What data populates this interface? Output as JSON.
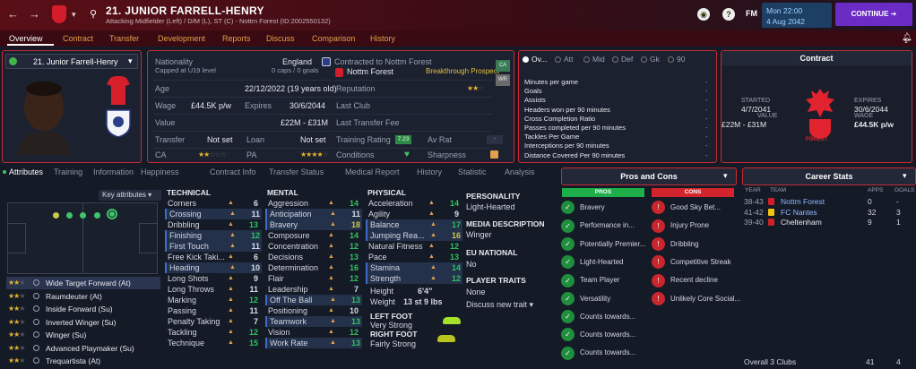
{
  "header": {
    "player_name": "21. JUNIOR FARRELL-HENRY",
    "player_subtitle": "Attacking Midfielder (Left) / D/M (L), ST (C) - Nottm Forest (ID:2002550132)",
    "date_line1": "Mon 22:00",
    "date_line2": "4 Aug 2042",
    "continue_label": "CONTINUE",
    "fm_label": "FM",
    "notification_count": "1"
  },
  "menu": [
    "Overview",
    "Contract",
    "Transfer",
    "Development",
    "Reports",
    "Discuss",
    "Comparison",
    "History"
  ],
  "profile": {
    "selector_label": "21. Junior Farrell-Henry",
    "nationality_label": "Nationality",
    "nationality_value": "England",
    "caps_label": "Capped at U19 level",
    "caps_value": "0 caps / 0 goals",
    "contracted_label": "Contracted to Nottm Forest",
    "club_value": "Nottm Forest",
    "prospect": "Breakthrough Prospect",
    "age_label": "Age",
    "age_value": "22/12/2022 (19 years old)",
    "wage_label": "Wage",
    "wage_value": "£44.5K p/w",
    "expires_label": "Expires",
    "expires_value": "30/6/2044",
    "value_label": "Value",
    "value_value": "£22M - £31M",
    "transfer_label": "Transfer",
    "transfer_value": "Not set",
    "loan_label": "Loan",
    "loan_value": "Not set",
    "ca_label": "CA",
    "pa_label": "PA",
    "reputation_label": "Reputation",
    "last_club_label": "Last Club",
    "last_transfer_label": "Last Transfer Fee",
    "training_label": "Training Rating",
    "training_value": "7.23",
    "avrat_label": "Av Rat",
    "avrat_value": "-",
    "conditions_label": "Conditions",
    "sharpness_label": "Sharpness",
    "badge_top": "CA",
    "badge_bottom": "WR"
  },
  "stats_panel": {
    "tabs": [
      "Ov...",
      "Att",
      "Mid",
      "Def",
      "Gk",
      "90"
    ],
    "rows": [
      {
        "label": "Minutes per game",
        "value": "-"
      },
      {
        "label": "Goals",
        "value": "-"
      },
      {
        "label": "Assists",
        "value": "-"
      },
      {
        "label": "Headers won per 90 minutes",
        "value": "-"
      },
      {
        "label": "Cross Completion Ratio",
        "value": "-"
      },
      {
        "label": "Passes completed per 90 minutes",
        "value": "-"
      },
      {
        "label": "Tackles Per Game",
        "value": "-"
      },
      {
        "label": "Interceptions per 90 minutes",
        "value": "-"
      },
      {
        "label": "Distance Covered Per 90 minutes",
        "value": "-"
      }
    ]
  },
  "contract": {
    "title": "Contract",
    "started_label": "STARTED",
    "started_value": "4/7/2041",
    "value_label": "VALUE",
    "value_value": "£22M - £31M",
    "expires_label": "EXPIRES",
    "expires_value": "30/6/2044",
    "wage_label": "WAGE",
    "wage_value": "£44.5K p/w",
    "crest_text": "FOREST"
  },
  "subnav": [
    "Attributes",
    "Training",
    "Information",
    "Happiness",
    "Contract Info",
    "Transfer Status",
    "Medical Report",
    "History",
    "Statistic",
    "Analysis"
  ],
  "key_attributes_label": "Key attributes",
  "technical": {
    "title": "TECHNICAL",
    "items": [
      {
        "name": "Corners",
        "value": "6",
        "color": "w",
        "hl": false
      },
      {
        "name": "Crossing",
        "value": "11",
        "color": "w",
        "hl": true
      },
      {
        "name": "Dribbling",
        "value": "13",
        "color": "g",
        "hl": false
      },
      {
        "name": "Finishing",
        "value": "12",
        "color": "g",
        "hl": true
      },
      {
        "name": "First Touch",
        "value": "11",
        "color": "w",
        "hl": true
      },
      {
        "name": "Free Kick Taki...",
        "value": "6",
        "color": "w",
        "hl": false
      },
      {
        "name": "Heading",
        "value": "10",
        "color": "w",
        "hl": true
      },
      {
        "name": "Long Shots",
        "value": "9",
        "color": "w",
        "hl": false
      },
      {
        "name": "Long Throws",
        "value": "11",
        "color": "w",
        "hl": false
      },
      {
        "name": "Marking",
        "value": "12",
        "color": "g",
        "hl": false
      },
      {
        "name": "Passing",
        "value": "11",
        "color": "w",
        "hl": false
      },
      {
        "name": "Penalty Taking",
        "value": "7",
        "color": "w",
        "hl": false
      },
      {
        "name": "Tackling",
        "value": "12",
        "color": "g",
        "hl": false
      },
      {
        "name": "Technique",
        "value": "15",
        "color": "g",
        "hl": false
      }
    ]
  },
  "mental": {
    "title": "MENTAL",
    "items": [
      {
        "name": "Aggression",
        "value": "14",
        "color": "g",
        "hl": false
      },
      {
        "name": "Anticipation",
        "value": "11",
        "color": "w",
        "hl": true
      },
      {
        "name": "Bravery",
        "value": "18",
        "color": "y",
        "hl": true
      },
      {
        "name": "Composure",
        "value": "14",
        "color": "g",
        "hl": false
      },
      {
        "name": "Concentration",
        "value": "12",
        "color": "g",
        "hl": false
      },
      {
        "name": "Decisions",
        "value": "13",
        "color": "g",
        "hl": false
      },
      {
        "name": "Determination",
        "value": "16",
        "color": "g",
        "hl": false
      },
      {
        "name": "Flair",
        "value": "12",
        "color": "g",
        "hl": false
      },
      {
        "name": "Leadership",
        "value": "7",
        "color": "w",
        "hl": false
      },
      {
        "name": "Off The Ball",
        "value": "13",
        "color": "g",
        "hl": true
      },
      {
        "name": "Positioning",
        "value": "10",
        "color": "w",
        "hl": false
      },
      {
        "name": "Teamwork",
        "value": "13",
        "color": "g",
        "hl": true
      },
      {
        "name": "Vision",
        "value": "12",
        "color": "g",
        "hl": false
      },
      {
        "name": "Work Rate",
        "value": "13",
        "color": "g",
        "hl": true
      }
    ]
  },
  "physical": {
    "title": "PHYSICAL",
    "items": [
      {
        "name": "Acceleration",
        "value": "14",
        "color": "g",
        "hl": false
      },
      {
        "name": "Agility",
        "value": "9",
        "color": "w",
        "hl": false
      },
      {
        "name": "Balance",
        "value": "17",
        "color": "g",
        "hl": true
      },
      {
        "name": "Jumping Rea...",
        "value": "16",
        "color": "y",
        "hl": true
      },
      {
        "name": "Natural Fitness",
        "value": "12",
        "color": "g",
        "hl": false
      },
      {
        "name": "Pace",
        "value": "13",
        "color": "g",
        "hl": false
      },
      {
        "name": "Stamina",
        "value": "14",
        "color": "g",
        "hl": true
      },
      {
        "name": "Strength",
        "value": "12",
        "color": "g",
        "hl": true
      }
    ],
    "height_label": "Height",
    "height_value": "6'4\"",
    "weight_label": "Weight",
    "weight_value": "13 st 9 lbs",
    "left_foot_label": "LEFT FOOT",
    "left_foot_value": "Very Strong",
    "right_foot_label": "RIGHT FOOT",
    "right_foot_value": "Fairly Strong"
  },
  "personality": {
    "personality_label": "PERSONALITY",
    "personality_value": "Light-Hearted",
    "media_label": "MEDIA DESCRIPTION",
    "media_value": "Winger",
    "eu_label": "EU NATIONAL",
    "eu_value": "No",
    "traits_label": "PLAYER TRAITS",
    "traits_value": "None",
    "discuss_label": "Discuss new trait"
  },
  "roles": [
    {
      "name": "Wide Target Forward (At)",
      "stars": 2,
      "selected": true
    },
    {
      "name": "Raumdeuter (At)",
      "stars": 2,
      "selected": false
    },
    {
      "name": "Inside Forward (Su)",
      "stars": 2,
      "selected": false
    },
    {
      "name": "Inverted Winger (Su)",
      "stars": 2,
      "selected": false
    },
    {
      "name": "Winger (Su)",
      "stars": 2,
      "selected": false
    },
    {
      "name": "Advanced Playmaker (Su)",
      "stars": 2,
      "selected": false
    },
    {
      "name": "Trequartista (At)",
      "stars": 2,
      "selected": false
    }
  ],
  "pros_cons": {
    "title": "Pros and Cons",
    "pros_label": "PROS",
    "cons_label": "CONS",
    "pros": [
      "Bravery",
      "Performance in...",
      "Potentially Premier...",
      "Light-Hearted",
      "Team Player",
      "Versatility",
      "Counts towards...",
      "Counts towards...",
      "Counts towards..."
    ],
    "cons": [
      "Good Sky Bet...",
      "Injury Prone",
      "Dribbling",
      "Competitive Streak",
      "Recent decline",
      "Unlikely Core Social..."
    ]
  },
  "career": {
    "title": "Career Stats",
    "headers": {
      "year": "YEAR",
      "team": "TEAM",
      "apps": "APPS",
      "goals": "GOALS"
    },
    "rows": [
      {
        "year": "38-43",
        "team": "Nottm Forest",
        "apps": "0",
        "goals": "-"
      },
      {
        "year": "41-42",
        "team": "FC Nantes",
        "apps": "32",
        "goals": "3"
      },
      {
        "year": "39-40",
        "team": "Cheltenham",
        "apps": "9",
        "goals": "1"
      }
    ],
    "overall": "Overall 3 Clubs",
    "overall_apps": "41",
    "overall_goals": "4"
  }
}
